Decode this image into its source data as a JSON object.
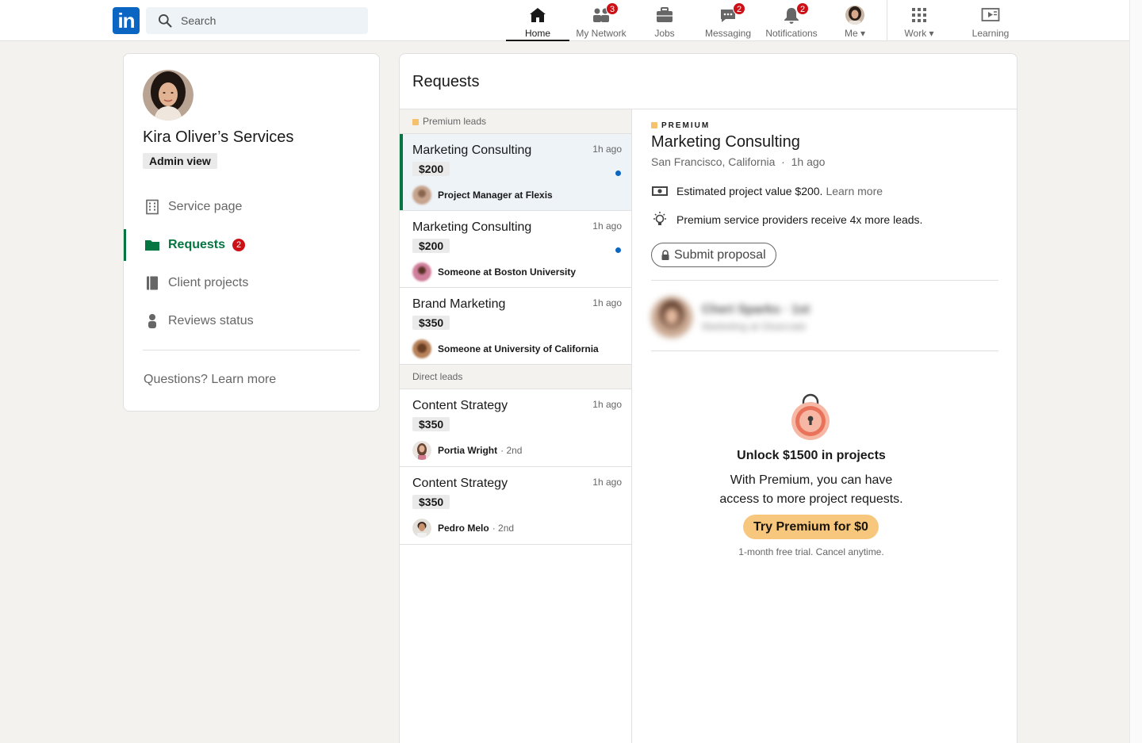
{
  "nav": {
    "logo": "in",
    "search_placeholder": "Search",
    "items": [
      {
        "label": "Home",
        "badge": ""
      },
      {
        "label": "My Network",
        "badge": "3"
      },
      {
        "label": "Jobs",
        "badge": ""
      },
      {
        "label": "Messaging",
        "badge": "2"
      },
      {
        "label": "Notifications",
        "badge": "2"
      },
      {
        "label": "Me ▾",
        "badge": ""
      },
      {
        "label": "Work ▾",
        "badge": ""
      },
      {
        "label": "Learning",
        "badge": ""
      }
    ]
  },
  "sidebar": {
    "title": "Kira Oliver’s Services",
    "admin_label": "Admin view",
    "items": [
      {
        "label": "Service page"
      },
      {
        "label": "Requests",
        "badge": "2"
      },
      {
        "label": "Client projects"
      },
      {
        "label": "Reviews status"
      }
    ],
    "questions": "Questions? Learn more"
  },
  "main": {
    "title": "Requests",
    "premium_section": "Premium leads",
    "direct_section": "Direct leads",
    "premium_leads": [
      {
        "title": "Marketing Consulting",
        "time": "1h ago",
        "price": "$200",
        "person": "Project Manager at Flexis",
        "degree": ""
      },
      {
        "title": "Marketing Consulting",
        "time": "1h ago",
        "price": "$200",
        "person": "Someone at Boston University",
        "degree": ""
      },
      {
        "title": "Brand Marketing",
        "time": "1h ago",
        "price": "$350",
        "person": "Someone at University of California",
        "degree": ""
      }
    ],
    "direct_leads": [
      {
        "title": "Content Strategy",
        "time": "1h ago",
        "price": "$350",
        "person": "Portia Wright",
        "degree": "· 2nd"
      },
      {
        "title": "Content Strategy",
        "time": "1h ago",
        "price": "$350",
        "person": "Pedro Melo",
        "degree": "· 2nd"
      }
    ]
  },
  "detail": {
    "premium_tag": "PREMIUM",
    "title": "Marketing Consulting",
    "location": "San Francisco, California",
    "time": "1h ago",
    "estimated": "Estimated project value $200.",
    "learn_more": "Learn more",
    "premium_note": "Premium service providers receive 4x more leads.",
    "submit": "Submit proposal",
    "blurred_name": "Cheri Sparks",
    "blurred_deg": "· 1st",
    "blurred_sub": "Marketing at Gluecrate",
    "unlock_title": "Unlock $1500 in projects",
    "unlock_body_1": "With Premium, you can have",
    "unlock_body_2": "access to more project requests.",
    "try_button": "Try Premium for $0",
    "trial_note": "1-month free trial. Cancel anytime."
  },
  "colors": {
    "brand": "#0a66c2",
    "accent_green": "#057642",
    "badge_red": "#cc1016",
    "premium_gold": "#f8c77e"
  }
}
